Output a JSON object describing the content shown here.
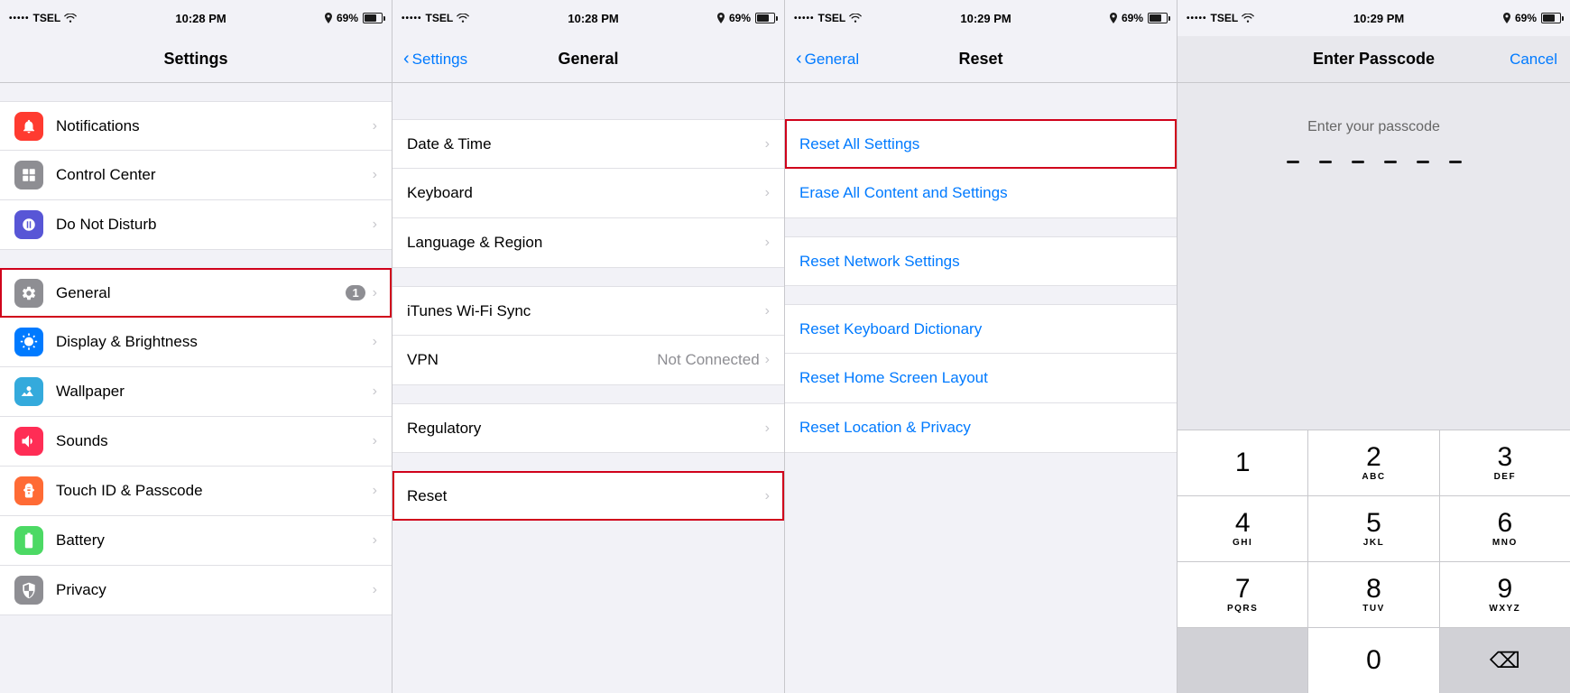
{
  "panels": [
    {
      "id": "settings",
      "statusBar": {
        "carrier": "•••••TSEL",
        "wifi": "wifi",
        "time": "10:28 PM",
        "location": true,
        "battery": "69%"
      },
      "navBar": {
        "title": "Settings",
        "backLabel": null
      },
      "sections": [
        {
          "items": [
            {
              "icon": "notifications",
              "iconBg": "#ff3b30",
              "iconSymbol": "🔔",
              "label": "Notifications",
              "badge": null,
              "value": null
            },
            {
              "icon": "control-center",
              "iconBg": "#8e8e93",
              "iconSymbol": "⊞",
              "label": "Control Center",
              "badge": null,
              "value": null
            },
            {
              "icon": "do-not-disturb",
              "iconBg": "#5856d6",
              "iconSymbol": "🌙",
              "label": "Do Not Disturb",
              "badge": null,
              "value": null
            }
          ]
        },
        {
          "items": [
            {
              "icon": "general",
              "iconBg": "#8e8e93",
              "iconSymbol": "⚙",
              "label": "General",
              "badge": "1",
              "value": null,
              "highlighted": true
            },
            {
              "icon": "display-brightness",
              "iconBg": "#007aff",
              "iconSymbol": "AA",
              "label": "Display & Brightness",
              "badge": null,
              "value": null
            },
            {
              "icon": "wallpaper",
              "iconBg": "#34aadc",
              "iconSymbol": "🌐",
              "label": "Wallpaper",
              "badge": null,
              "value": null
            },
            {
              "icon": "sounds",
              "iconBg": "#ff2d55",
              "iconSymbol": "🔊",
              "label": "Sounds",
              "badge": null,
              "value": null
            },
            {
              "icon": "touch-id",
              "iconBg": "#ff6b35",
              "iconSymbol": "👆",
              "label": "Touch ID & Passcode",
              "badge": null,
              "value": null
            },
            {
              "icon": "battery",
              "iconBg": "#4cd964",
              "iconSymbol": "🔋",
              "label": "Battery",
              "badge": null,
              "value": null
            },
            {
              "icon": "privacy",
              "iconBg": "#8e8e93",
              "iconSymbol": "✋",
              "label": "Privacy",
              "badge": null,
              "value": null
            }
          ]
        }
      ]
    },
    {
      "id": "general",
      "statusBar": {
        "carrier": "•••••TSEL",
        "wifi": "wifi",
        "time": "10:28 PM",
        "location": true,
        "battery": "69%"
      },
      "navBar": {
        "title": "General",
        "backLabel": "Settings"
      },
      "sections": [
        {
          "items": [
            {
              "label": "Date & Time",
              "value": null
            },
            {
              "label": "Keyboard",
              "value": null
            },
            {
              "label": "Language & Region",
              "value": null
            }
          ]
        },
        {
          "items": [
            {
              "label": "iTunes Wi-Fi Sync",
              "value": null
            },
            {
              "label": "VPN",
              "value": "Not Connected"
            }
          ]
        },
        {
          "items": [
            {
              "label": "Regulatory",
              "value": null
            }
          ]
        },
        {
          "items": [
            {
              "label": "Reset",
              "value": null,
              "highlighted": true
            }
          ]
        }
      ]
    },
    {
      "id": "reset",
      "statusBar": {
        "carrier": "•••••TSEL",
        "wifi": "wifi",
        "time": "10:29 PM",
        "location": true,
        "battery": "69%"
      },
      "navBar": {
        "title": "Reset",
        "backLabel": "General"
      },
      "resetItems": [
        {
          "label": "Reset All Settings",
          "highlighted": true
        },
        {
          "label": "Erase All Content and Settings"
        }
      ],
      "resetItems2": [
        {
          "label": "Reset Network Settings"
        }
      ],
      "resetItems3": [
        {
          "label": "Reset Keyboard Dictionary"
        },
        {
          "label": "Reset Home Screen Layout"
        },
        {
          "label": "Reset Location & Privacy"
        }
      ]
    },
    {
      "id": "passcode",
      "statusBar": {
        "carrier": "•••••TSEL",
        "wifi": "wifi",
        "time": "10:29 PM",
        "location": true,
        "battery": "69%"
      },
      "navBar": {
        "title": "Enter Passcode",
        "cancelLabel": "Cancel"
      },
      "hint": "Enter your passcode",
      "keypad": [
        [
          {
            "number": "1",
            "letters": ""
          },
          {
            "number": "2",
            "letters": "ABC"
          },
          {
            "number": "3",
            "letters": "DEF"
          }
        ],
        [
          {
            "number": "4",
            "letters": "GHI"
          },
          {
            "number": "5",
            "letters": "JKL"
          },
          {
            "number": "6",
            "letters": "MNO"
          }
        ],
        [
          {
            "number": "7",
            "letters": "PQRS"
          },
          {
            "number": "8",
            "letters": "TUV"
          },
          {
            "number": "9",
            "letters": "WXYZ"
          }
        ],
        [
          {
            "number": "",
            "letters": "",
            "type": "empty"
          },
          {
            "number": "0",
            "letters": ""
          },
          {
            "number": "⌫",
            "letters": "",
            "type": "delete"
          }
        ]
      ]
    }
  ]
}
